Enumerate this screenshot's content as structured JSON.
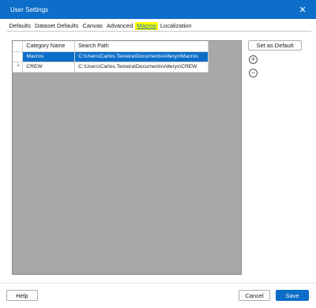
{
  "window": {
    "title": "User Settings",
    "close_glyph": "✕"
  },
  "tabs": [
    {
      "label": "Defaults",
      "active": false
    },
    {
      "label": "Dataset Defaults",
      "active": false
    },
    {
      "label": "Canvas",
      "active": false
    },
    {
      "label": "Advanced",
      "active": false
    },
    {
      "label": "Macros",
      "active": true
    },
    {
      "label": "Localization",
      "active": false
    }
  ],
  "grid": {
    "columns": [
      "Category Name",
      "Search Path"
    ],
    "rows": [
      {
        "marker": "",
        "category": "Macros",
        "path": "C:\\Users\\Carlos.Teixeira\\Documents\\Alteryx\\Macros",
        "selected": true
      },
      {
        "marker": "*",
        "category": "CREW",
        "path": "C:\\Users\\Carlos.Teixeira\\Documents\\Alteryx\\CREW",
        "selected": false
      }
    ]
  },
  "side_buttons": {
    "set_default": "Set as Default",
    "add_glyph": "+",
    "remove_glyph": "−"
  },
  "footer": {
    "help": "Help",
    "cancel": "Cancel",
    "save": "Save"
  },
  "colors": {
    "accent": "#0c6ec9",
    "highlight": "#ffff00",
    "grid_bg": "#a8a8a8"
  }
}
